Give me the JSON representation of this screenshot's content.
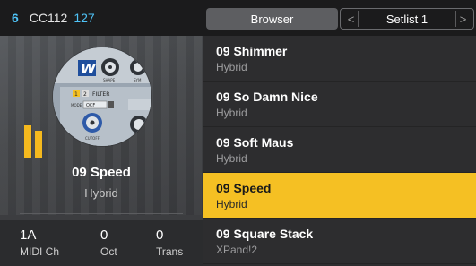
{
  "header": {
    "program_number": "6",
    "cc_label": "CC112",
    "cc_value": "127"
  },
  "current_sound": {
    "name": "09 Speed",
    "type": "Hybrid",
    "art_labels": [
      "W",
      "SHAPE",
      "SYM",
      "1",
      "2",
      "FILTER",
      "MODE",
      "OCF",
      "CUTOFF"
    ]
  },
  "params": [
    {
      "value": "1A",
      "label": "MIDI Ch"
    },
    {
      "value": "0",
      "label": "Oct"
    },
    {
      "value": "0",
      "label": "Trans"
    }
  ],
  "browser": {
    "browser_label": "Browser",
    "setlist_label": "Setlist 1",
    "prev_icon": "<",
    "next_icon": ">"
  },
  "sounds": [
    {
      "title": "09 Shimmer",
      "subtitle": "Hybrid",
      "selected": false
    },
    {
      "title": "09 So Damn Nice",
      "subtitle": "Hybrid",
      "selected": false
    },
    {
      "title": "09 Soft Maus",
      "subtitle": "Hybrid",
      "selected": false
    },
    {
      "title": "09 Speed",
      "subtitle": "Hybrid",
      "selected": true
    },
    {
      "title": "09 Square Stack",
      "subtitle": "XPand!2",
      "selected": false
    }
  ],
  "colors": {
    "accent": "#f5c023",
    "cc_blue": "#4fc3f7"
  }
}
